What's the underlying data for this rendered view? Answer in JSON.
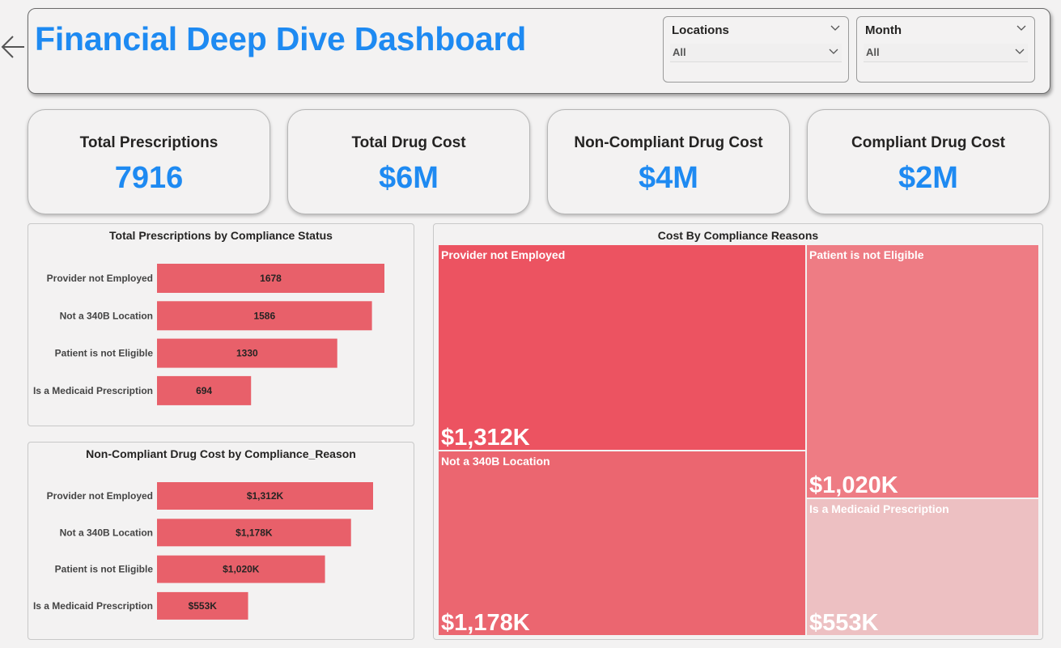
{
  "header": {
    "title": "Financial Deep Dive Dashboard"
  },
  "filters": [
    {
      "label": "Locations",
      "value": "All"
    },
    {
      "label": "Month",
      "value": "All"
    }
  ],
  "kpis": [
    {
      "label": "Total Prescriptions",
      "value": "7916"
    },
    {
      "label": "Total Drug Cost",
      "value": "$6M"
    },
    {
      "label": "Non-Compliant Drug Cost",
      "value": "$4M"
    },
    {
      "label": "Compliant Drug Cost",
      "value": "$2M"
    }
  ],
  "colors": {
    "accent": "#1e8af2",
    "bar": "#e8606a"
  },
  "chart_data": [
    {
      "type": "bar",
      "orientation": "horizontal",
      "title": "Total Prescriptions by Compliance Status",
      "categories": [
        "Provider not Employed",
        "Not a 340B Location",
        "Patient is not Eligible",
        "Is a Medicaid Prescription"
      ],
      "values": [
        1678,
        1586,
        1330,
        694
      ],
      "labels": [
        "1678",
        "1586",
        "1330",
        "694"
      ],
      "bar_color": "#e8606a"
    },
    {
      "type": "bar",
      "orientation": "horizontal",
      "title": "Non-Compliant Drug Cost by Compliance_Reason",
      "categories": [
        "Provider not Employed",
        "Not a 340B Location",
        "Patient is not Eligible",
        "Is a Medicaid Prescription"
      ],
      "values": [
        1312,
        1178,
        1020,
        553
      ],
      "labels": [
        "$1,312K",
        "$1,178K",
        "$1,020K",
        "$553K"
      ],
      "bar_color": "#e8606a"
    },
    {
      "type": "treemap",
      "title": "Cost By Compliance Reasons",
      "items": [
        {
          "name": "Provider not Employed",
          "value": 1312,
          "label": "$1,312K",
          "color": "#ec5361"
        },
        {
          "name": "Not a 340B Location",
          "value": 1178,
          "label": "$1,178K",
          "color": "#eb6670"
        },
        {
          "name": "Patient is not Eligible",
          "value": 1020,
          "label": "$1,020K",
          "color": "#ee7c84"
        },
        {
          "name": "Is a Medicaid Prescription",
          "value": 553,
          "label": "$553K",
          "color": "#edc0c2"
        }
      ]
    }
  ]
}
